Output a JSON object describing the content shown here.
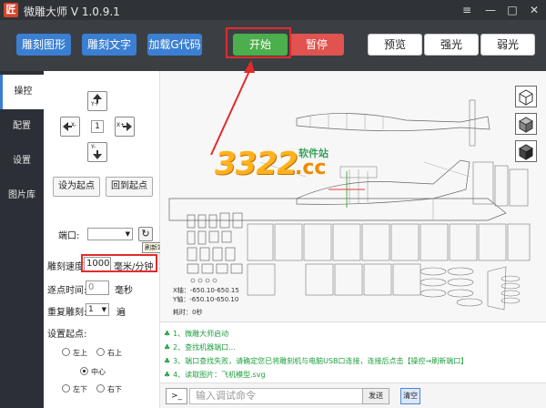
{
  "window": {
    "title": "微雕大师 V 1.0.9.1",
    "app_icon_glyph": "匠",
    "controls": [
      "menu-icon",
      "minimize-icon",
      "maximize-icon",
      "close-icon"
    ]
  },
  "toolbar": {
    "engrave_image": "雕刻图形",
    "engrave_text": "雕刻文字",
    "load_gcode": "加载G代码",
    "start": "开始",
    "pause": "暂停",
    "preview": "预览",
    "strong_light": "强光",
    "weak_light": "弱光"
  },
  "sidebar": {
    "tabs": [
      {
        "label": "操控",
        "active": true
      },
      {
        "label": "配置",
        "active": false
      },
      {
        "label": "设置",
        "active": false
      },
      {
        "label": "图片库",
        "active": false
      }
    ]
  },
  "control": {
    "jog": {
      "up": "Y+",
      "down": "Y-",
      "left": "X-",
      "right": "X+",
      "step": "1"
    },
    "set_origin": "设为起点",
    "return_origin": "回到起点",
    "port_label": "端口:",
    "port_value": "",
    "refresh_tooltip": "刷新端口",
    "speed_label": "雕刻速度:",
    "speed_value": "1000",
    "speed_unit": "毫米/分钟",
    "dwell_label": "逐点时间:",
    "dwell_value": "0",
    "dwell_unit": "毫秒",
    "repeat_label": "重复雕刻:",
    "repeat_value": "1",
    "repeat_unit": "遍",
    "origin_label": "设置起点:",
    "origin_options": {
      "top_left": "左上",
      "top_right": "右上",
      "center": "中心",
      "bottom_left": "左下",
      "bottom_right": "右下"
    },
    "origin_selected": "中心"
  },
  "canvas": {
    "x_readout": "X轴：-650.10-650.15",
    "y_readout": "Y轴：-650.10-650.10",
    "time_readout": "耗时：0秒",
    "watermark": {
      "number": "3322",
      "suffix": ".cc",
      "tagline": "软件站"
    },
    "view_buttons": [
      "cube-wireframe-icon",
      "cube-solid-icon",
      "cube-dark-icon"
    ]
  },
  "log": {
    "lines": [
      "1、微雕大师启动",
      "2、查找机器端口...",
      "3、端口查找失败，请确定您已将雕刻机与电脑USB口连接，连接后点击【操控→刷新端口】",
      "4、读取图片：飞机模型.svg"
    ],
    "color": "#1e9e3e"
  },
  "command": {
    "prompt": ">_",
    "placeholder": "输入调试命令",
    "send": "发送",
    "clear": "清空"
  },
  "colors": {
    "accent_blue": "#3a7fd1",
    "start_green": "#4cae4c",
    "pause_red": "#e0534f",
    "highlight_red": "#e32b2b"
  }
}
